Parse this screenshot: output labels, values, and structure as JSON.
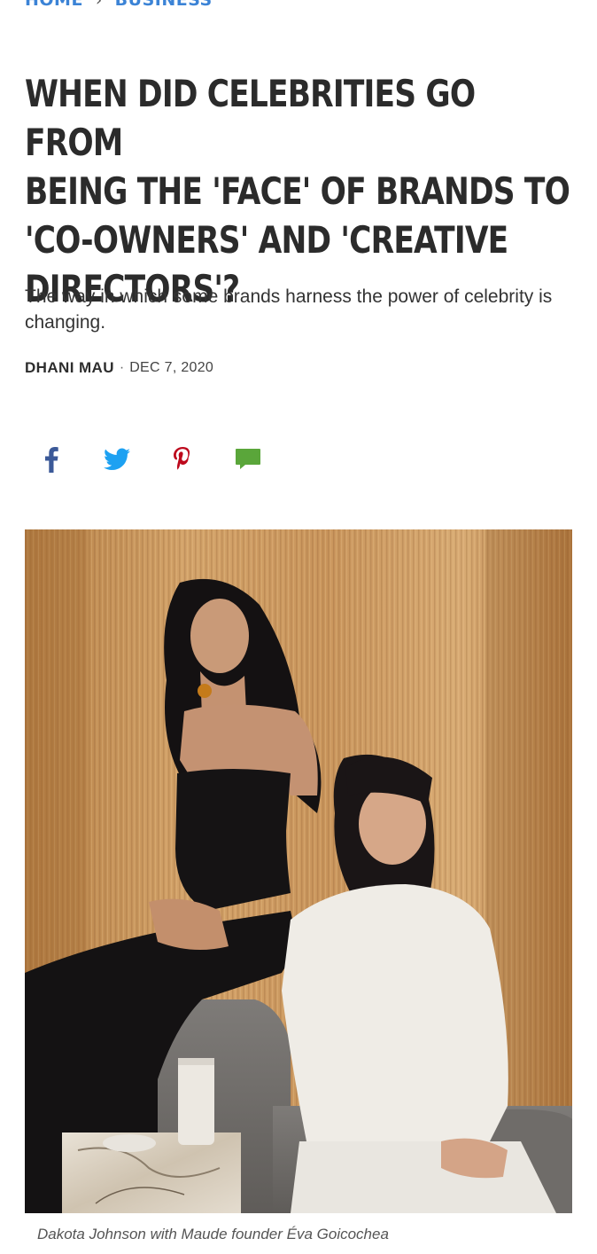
{
  "breadcrumb": {
    "home": "HOME",
    "separator": "›",
    "section": "BUSINESS"
  },
  "article": {
    "title": "WHEN DID CELEBRITIES GO FROM BEING THE 'FACE' OF BRANDS TO 'CO-OWNERS' AND 'CREATIVE DIRECTORS'?",
    "title_lines": [
      "WHEN DID CELEBRITIES GO FROM",
      "BEING THE 'FACE' OF BRANDS TO",
      "'CO-OWNERS' AND 'CREATIVE",
      "DIRECTORS'?"
    ],
    "dek": "The way in which some brands harness the power of celebrity is changing.",
    "author": "DHANI MAU",
    "byline_separator": "·",
    "date": "DEC 7, 2020"
  },
  "share": {
    "icons": [
      "facebook-icon",
      "twitter-icon",
      "pinterest-icon",
      "comment-icon"
    ],
    "colors": {
      "facebook": "#3b5998",
      "twitter": "#1da1f2",
      "pinterest": "#bd081c",
      "comment": "#5aa63a"
    }
  },
  "image": {
    "caption": "Dakota Johnson with Maude founder Éva Goicochea"
  },
  "colors": {
    "link": "#3b83d6",
    "title": "#2b2b2b",
    "text": "#333333"
  }
}
